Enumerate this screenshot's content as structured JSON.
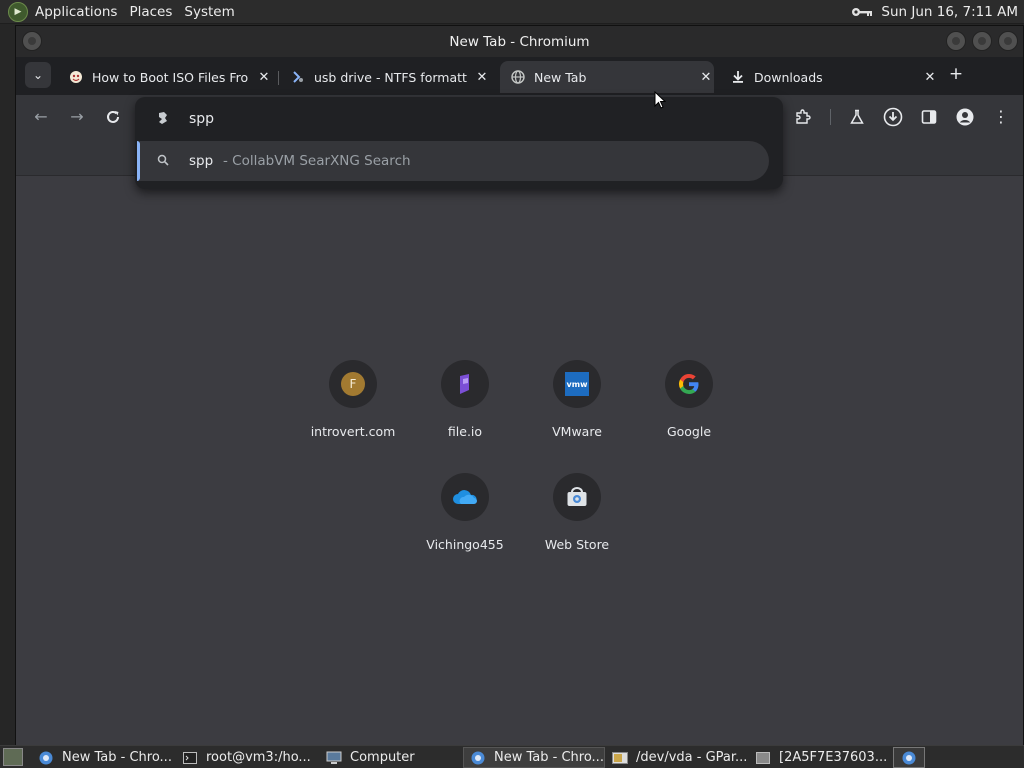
{
  "top_panel": {
    "menus": [
      "Applications",
      "Places",
      "System"
    ],
    "clock": "Sun Jun 16,  7:11 AM"
  },
  "window": {
    "title": "New Tab - Chromium"
  },
  "tabs": [
    {
      "title": "How to Boot ISO Files Fro",
      "active": false
    },
    {
      "title": "usb drive - NTFS formatti",
      "active": false
    },
    {
      "title": "New Tab",
      "active": true
    },
    {
      "title": "Downloads",
      "active": false
    }
  ],
  "omnibox": {
    "value": "spp",
    "suggestion_query": "spp",
    "suggestion_desc": " - CollabVM SearXNG Search"
  },
  "shortcuts": [
    {
      "label": "introvert.com",
      "letter": "F"
    },
    {
      "label": "file.io"
    },
    {
      "label": "VMware",
      "badge": "vmw"
    },
    {
      "label": "Google",
      "badge": "G"
    },
    {
      "label": "Vichingo455"
    },
    {
      "label": "Web Store"
    }
  ],
  "taskbar": [
    {
      "label": "New Tab - Chro..."
    },
    {
      "label": "root@vm3:/ho..."
    },
    {
      "label": "Computer"
    },
    {
      "label": "New Tab - Chro..."
    },
    {
      "label": "/dev/vda - GPar..."
    },
    {
      "label": "[2A5F7E37603..."
    }
  ],
  "colors": {
    "accent": "#8ab4f8",
    "ntp_background": "#3c3c41",
    "omnibox_background": "#202124"
  }
}
